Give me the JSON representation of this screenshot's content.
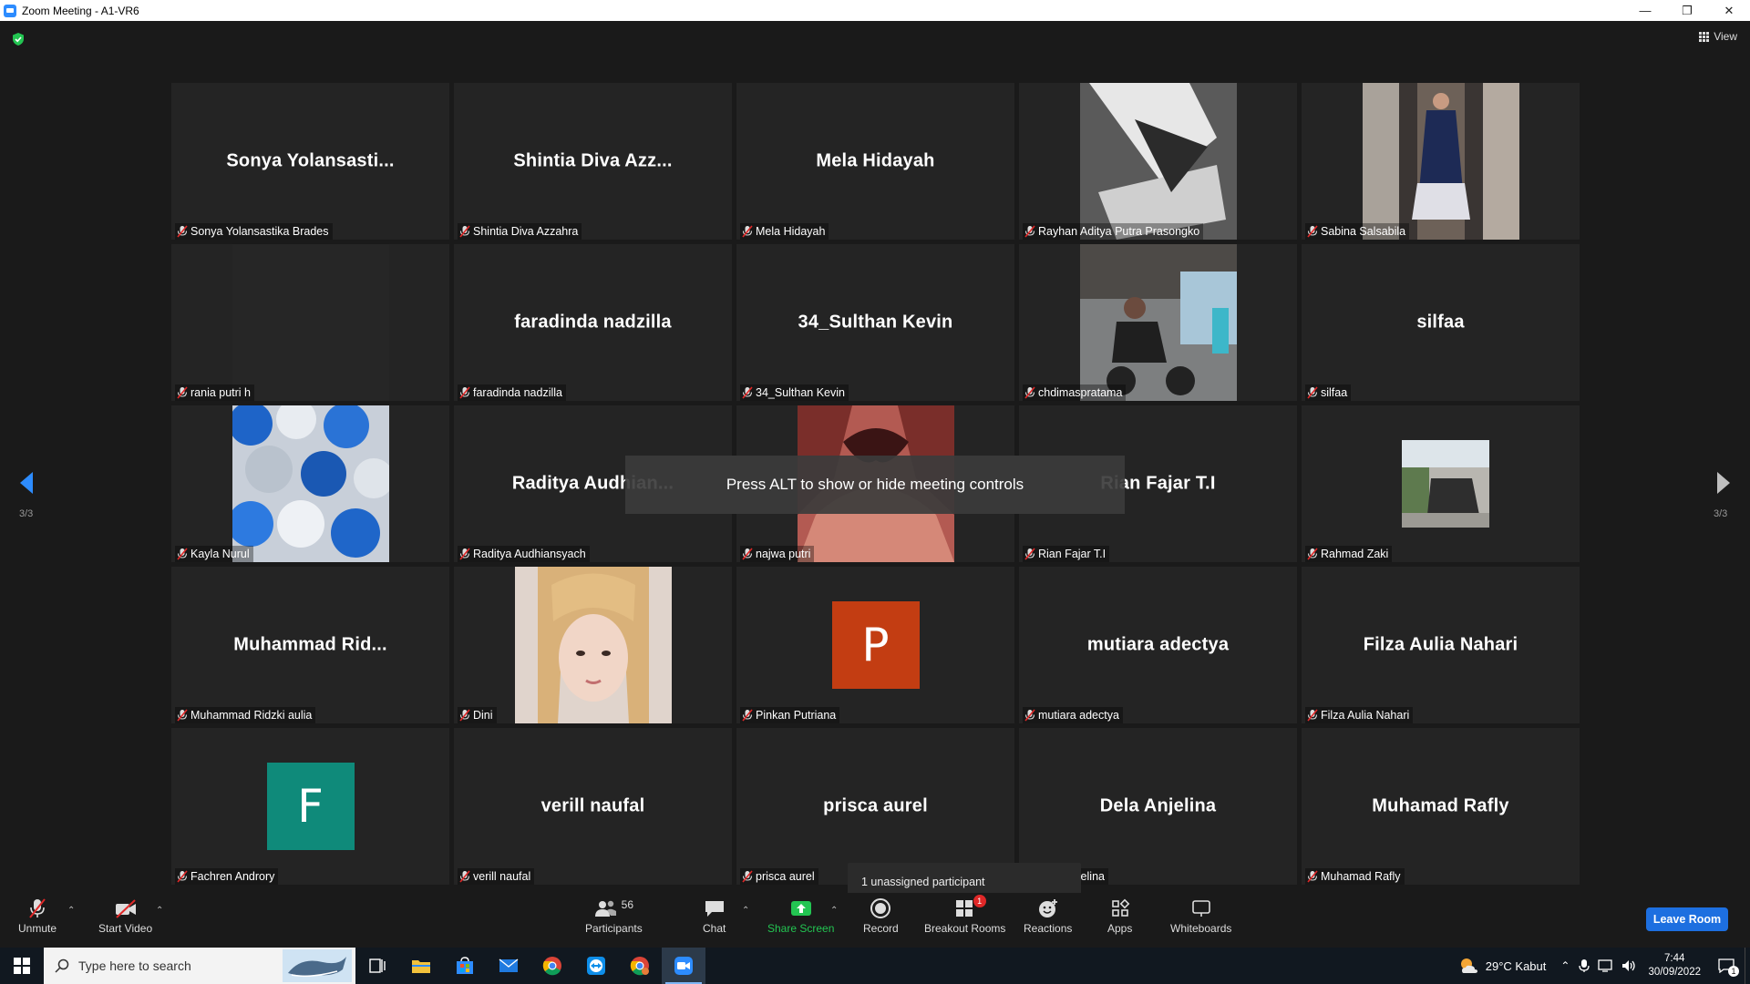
{
  "window": {
    "title": "Zoom Meeting - A1-VR6"
  },
  "top": {
    "view_label": "View"
  },
  "participants": [
    {
      "display": "Sonya  Yolansasti...",
      "name": "Sonya Yolansastika Brades",
      "kind": "text"
    },
    {
      "display": "Shintia  Diva  Azz...",
      "name": "Shintia Diva Azzahra",
      "kind": "text"
    },
    {
      "display": "Mela Hidayah",
      "name": "Mela Hidayah",
      "kind": "text"
    },
    {
      "display": "",
      "name": "Rayhan Aditya Putra Prasongko",
      "kind": "photo",
      "photo": "shoes"
    },
    {
      "display": "",
      "name": "Sabina Salsabila",
      "kind": "photo",
      "photo": "person-hall"
    },
    {
      "display": "",
      "name": "rania putri h",
      "kind": "photo",
      "photo": "dark"
    },
    {
      "display": "faradinda nadzilla",
      "name": "faradinda nadzilla",
      "kind": "text"
    },
    {
      "display": "34_Sulthan Kevin",
      "name": "34_Sulthan Kevin",
      "kind": "text"
    },
    {
      "display": "",
      "name": "chdimaspratama",
      "kind": "photo",
      "photo": "street"
    },
    {
      "display": "silfaa",
      "name": "silfaa",
      "kind": "text"
    },
    {
      "display": "",
      "name": "Kayla Nurul",
      "kind": "photo",
      "photo": "balloons"
    },
    {
      "display": "Raditya  Audhian...",
      "name": "Raditya Audhiansyach",
      "kind": "text"
    },
    {
      "display": "",
      "name": "najwa putri",
      "kind": "photo",
      "photo": "hair"
    },
    {
      "display": "Rian Fajar T.I",
      "name": "Rian Fajar T.I",
      "kind": "text"
    },
    {
      "display": "",
      "name": "Rahmad Zaki",
      "kind": "photo",
      "photo": "small"
    },
    {
      "display": "Muhammad  Rid...",
      "name": "Muhammad Ridzki aulia",
      "kind": "text"
    },
    {
      "display": "",
      "name": "Dini",
      "kind": "photo",
      "photo": "face"
    },
    {
      "display": "P",
      "name": "Pinkan Putriana",
      "kind": "avatar",
      "color": "#c33d12"
    },
    {
      "display": "mutiara adectya",
      "name": "mutiara adectya",
      "kind": "text"
    },
    {
      "display": "Filza Aulia Nahari",
      "name": "Filza Aulia Nahari",
      "kind": "text"
    },
    {
      "display": "F",
      "name": "Fachren Androry",
      "kind": "avatar",
      "color": "#0f8a7a"
    },
    {
      "display": "verill naufal",
      "name": "verill naufal",
      "kind": "text"
    },
    {
      "display": "prisca aurel",
      "name": "prisca aurel",
      "kind": "text"
    },
    {
      "display": "Dela Anjelina",
      "name": "Dela Anjelina",
      "kind": "text"
    },
    {
      "display": "Muhamad Rafly",
      "name": "Muhamad Rafly",
      "kind": "text"
    }
  ],
  "paging": {
    "left": "3/3",
    "right": "3/3"
  },
  "banner": "Press ALT to show or hide meeting controls",
  "unassigned": "1 unassigned participant",
  "toolbar": {
    "unmute": "Unmute",
    "start_video": "Start Video",
    "participants": "Participants",
    "participants_count": "56",
    "chat": "Chat",
    "share_screen": "Share Screen",
    "record": "Record",
    "breakout_rooms": "Breakout Rooms",
    "breakout_badge": "1",
    "reactions": "Reactions",
    "apps": "Apps",
    "whiteboards": "Whiteboards",
    "leave": "Leave Room"
  },
  "taskbar": {
    "search_placeholder": "Type here to search",
    "weather": "29°C  Kabut",
    "time": "7:44",
    "date": "30/09/2022",
    "notifications": "1"
  },
  "colors": {
    "accent": "#1d6fe0",
    "share_green": "#23c552",
    "mute_red": "#e02828"
  }
}
